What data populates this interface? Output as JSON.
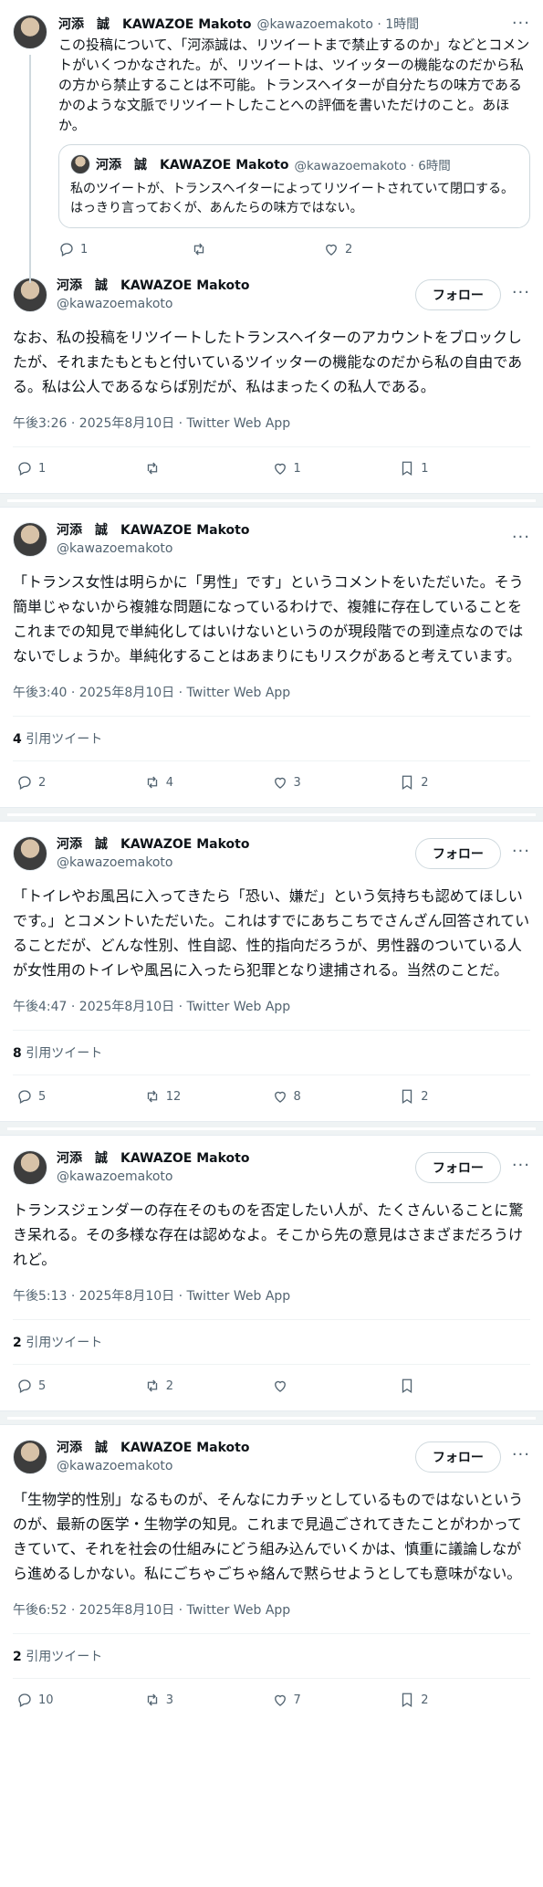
{
  "reply": {
    "author_name": "河添　誠　KAWAZOE Makoto",
    "handle_time": "@kawazoemakoto · 1時間",
    "text": "この投稿について、「河添誠は、リツイートまで禁止するのか」などとコメントがいくつかなされた。が、リツイートは、ツイッターの機能なのだから私の方から禁止することは不可能。トランスヘイターが自分たちの味方であるかのような文脈でリツイートしたことへの評価を書いただけのこと。あほか。",
    "quote": {
      "author_name": "河添　誠　KAWAZOE Makoto",
      "handle_time": "@kawazoemakoto · 6時間",
      "text": "私のツイートが、トランスヘイターによってリツイートされていて閉口する。はっきり言っておくが、あんたらの味方ではない。"
    },
    "counts": {
      "replies": "1",
      "retweets": "",
      "likes": "2"
    }
  },
  "tweets": [
    {
      "author_name": "河添　誠　KAWAZOE Makoto",
      "handle": "@kawazoemakoto",
      "follow_label": "フォロー",
      "text": "なお、私の投稿をリツイートしたトランスヘイターのアカウントをブロックしたが、それまたもともと付いているツイッターの機能なのだから私の自由である。私は公人であるならば別だが、私はまったくの私人である。",
      "meta": "午後3:26 · 2025年8月10日 · Twitter Web App",
      "quote_count": "",
      "quote_label": "",
      "counts": {
        "replies": "1",
        "retweets": "",
        "likes": "1",
        "bookmarks": "1"
      }
    },
    {
      "author_name": "河添　誠　KAWAZOE Makoto",
      "handle": "@kawazoemakoto",
      "follow_label": "",
      "text": "「トランス女性は明らかに「男性」です」というコメントをいただいた。そう簡単じゃないから複雑な問題になっているわけで、複雑に存在していることをこれまでの知見で単純化してはいけないというのが現段階での到達点なのではないでしょうか。単純化することはあまりにもリスクがあると考えています。",
      "meta": "午後3:40 · 2025年8月10日 · Twitter Web App",
      "quote_count": "4",
      "quote_label": "引用ツイート",
      "counts": {
        "replies": "2",
        "retweets": "4",
        "likes": "3",
        "bookmarks": "2"
      }
    },
    {
      "author_name": "河添　誠　KAWAZOE Makoto",
      "handle": "@kawazoemakoto",
      "follow_label": "フォロー",
      "text": "「トイレやお風呂に入ってきたら「恐い、嫌だ」という気持ちも認めてほしいです。」とコメントいただいた。これはすでにあちこちでさんざん回答されていることだが、どんな性別、性自認、性的指向だろうが、男性器のついている人が女性用のトイレや風呂に入ったら犯罪となり逮捕される。当然のことだ。",
      "meta": "午後4:47 · 2025年8月10日 · Twitter Web App",
      "quote_count": "8",
      "quote_label": "引用ツイート",
      "counts": {
        "replies": "5",
        "retweets": "12",
        "likes": "8",
        "bookmarks": "2"
      }
    },
    {
      "author_name": "河添　誠　KAWAZOE Makoto",
      "handle": "@kawazoemakoto",
      "follow_label": "フォロー",
      "text": "トランスジェンダーの存在そのものを否定したい人が、たくさんいることに驚き呆れる。その多様な存在は認めなよ。そこから先の意見はさまざまだろうけれど。",
      "meta": "午後5:13 · 2025年8月10日 · Twitter Web App",
      "quote_count": "2",
      "quote_label": "引用ツイート",
      "counts": {
        "replies": "5",
        "retweets": "2",
        "likes": "",
        "bookmarks": ""
      }
    },
    {
      "author_name": "河添　誠　KAWAZOE Makoto",
      "handle": "@kawazoemakoto",
      "follow_label": "フォロー",
      "text": "「生物学的性別」なるものが、そんなにカチッとしているものではないというのが、最新の医学・生物学の知見。これまで見過ごされてきたことがわかってきていて、それを社会の仕組みにどう組み込んでいくかは、慎重に議論しながら進めるしかない。私にごちゃごちゃ絡んで黙らせようとしても意味がない。",
      "meta": "午後6:52 · 2025年8月10日 · Twitter Web App",
      "quote_count": "2",
      "quote_label": "引用ツイート",
      "counts": {
        "replies": "10",
        "retweets": "3",
        "likes": "7",
        "bookmarks": "2"
      }
    }
  ]
}
